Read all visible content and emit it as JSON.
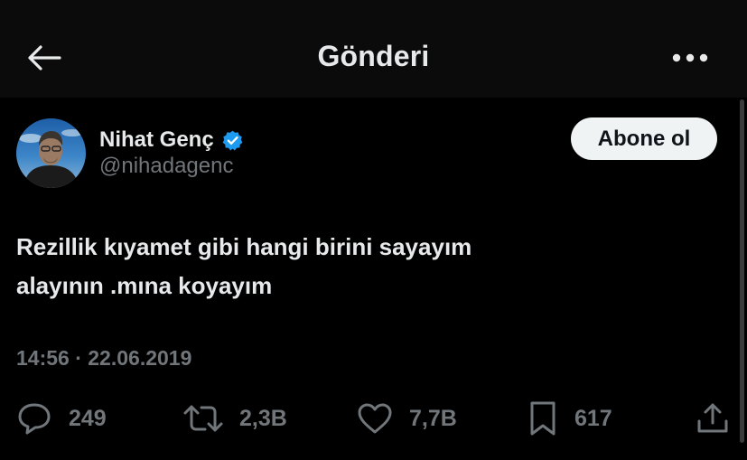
{
  "header": {
    "title": "Gönderi",
    "back_icon": "arrow-left-icon",
    "more_icon": "more-horizontal-icon"
  },
  "author": {
    "name": "Nihat Genç",
    "handle": "@nihadagenc",
    "verified": true,
    "verified_color": "#1d9bf0",
    "follow_label": "Abone ol"
  },
  "post": {
    "lines": [
      "Rezillik kıyamet gibi hangi birini sayayım",
      "alayının .mına koyayım"
    ],
    "timestamp": "14:56 · 22.06.2019"
  },
  "actions": {
    "replies": "249",
    "reposts": "2,3B",
    "likes": "7,7B",
    "bookmarks": "617"
  },
  "colors": {
    "background": "#000000",
    "text_primary": "#e7e9ea",
    "text_secondary": "#71767b",
    "accent": "#1d9bf0"
  }
}
